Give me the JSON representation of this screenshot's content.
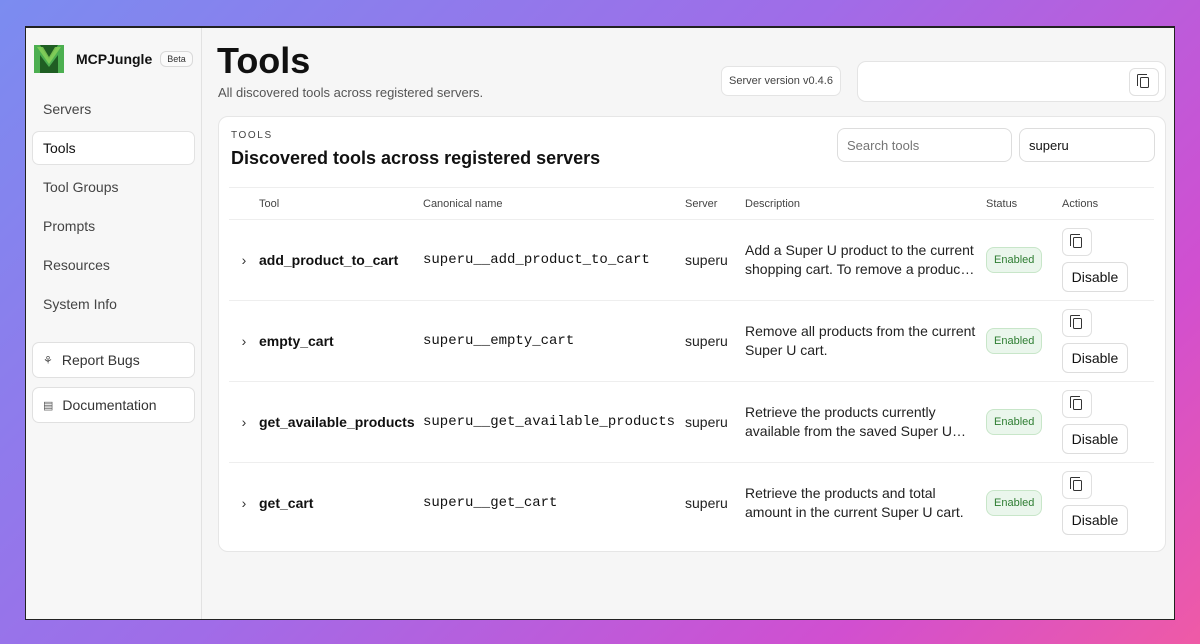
{
  "app": {
    "name": "MCPJungle",
    "badge": "Beta"
  },
  "sidebar": {
    "items": [
      {
        "label": "Servers",
        "active": false
      },
      {
        "label": "Tools",
        "active": true
      },
      {
        "label": "Tool Groups",
        "active": false
      },
      {
        "label": "Prompts",
        "active": false
      },
      {
        "label": "Resources",
        "active": false
      },
      {
        "label": "System Info",
        "active": false
      }
    ],
    "buttons": [
      {
        "label": "Report Bugs",
        "icon": "bug-icon"
      },
      {
        "label": "Documentation",
        "icon": "doc-icon"
      }
    ]
  },
  "header": {
    "title": "Tools",
    "subtitle": "All discovered tools across registered servers.",
    "server_version": "Server version v0.4.6",
    "url_value": ""
  },
  "card": {
    "eyebrow": "TOOLS",
    "title": "Discovered tools across registered servers",
    "search_placeholder": "Search tools",
    "search_value": "",
    "filter_value": "superu"
  },
  "table": {
    "columns": [
      "Tool",
      "Canonical name",
      "Server",
      "Description",
      "Status",
      "Actions"
    ],
    "rows": [
      {
        "tool": "add_product_to_cart",
        "canonical": "superu__add_product_to_cart",
        "server": "superu",
        "description": "Add a Super U product to the current shopping cart. To remove a product, use the quantity option.",
        "status": "Enabled",
        "action": "Disable"
      },
      {
        "tool": "empty_cart",
        "canonical": "superu__empty_cart",
        "server": "superu",
        "description": "Remove all products from the current Super U cart.",
        "status": "Enabled",
        "action": "Disable"
      },
      {
        "tool": "get_available_products",
        "canonical": "superu__get_available_products",
        "server": "superu",
        "description": "Retrieve the products currently available from the saved Super U store.",
        "status": "Enabled",
        "action": "Disable"
      },
      {
        "tool": "get_cart",
        "canonical": "superu__get_cart",
        "server": "superu",
        "description": "Retrieve the products and total amount in the current Super U cart.",
        "status": "Enabled",
        "action": "Disable"
      }
    ]
  },
  "colors": {
    "accent_green": "#2e7d32",
    "logo_green": "#2f8a2f"
  }
}
